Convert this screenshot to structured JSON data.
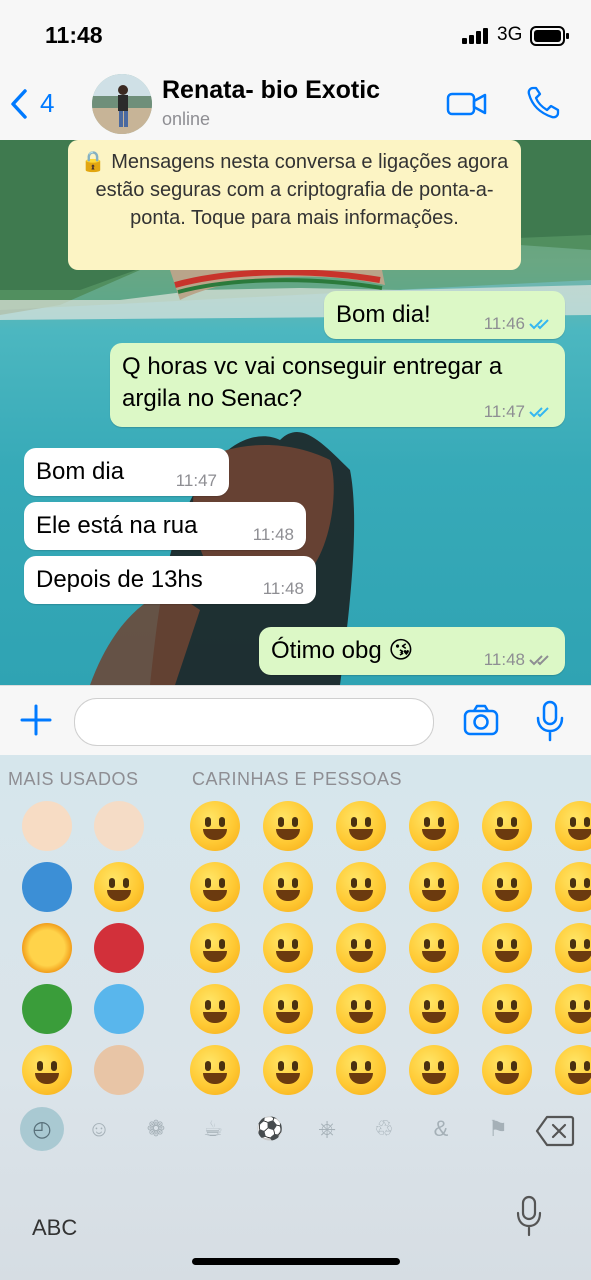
{
  "status_bar": {
    "time": "11:48",
    "network": "3G"
  },
  "nav": {
    "back_count": "4",
    "contact_name": "Renata- bio Exotic",
    "contact_status": "online"
  },
  "encryption_notice": "🔒 Mensagens nesta conversa e ligações agora estão seguras com a criptografia de ponta-a-ponta. Toque para mais informações.",
  "messages": [
    {
      "direction": "out",
      "text": "Bom dia!",
      "time": "11:46"
    },
    {
      "direction": "out",
      "text": "Q horas vc vai conseguir entregar a argila no Senac?",
      "time": "11:47"
    },
    {
      "direction": "in",
      "text": "Bom dia",
      "time": "11:47"
    },
    {
      "direction": "in",
      "text": "Ele está na rua",
      "time": "11:48"
    },
    {
      "direction": "in",
      "text": "Depois de 13hs",
      "time": "11:48"
    },
    {
      "direction": "out",
      "text": "Ótimo obg 😘",
      "time": "11:48"
    }
  ],
  "input": {
    "placeholder": ""
  },
  "keyboard": {
    "frequent_label": "MAIS USADOS",
    "smileys_label": "CARINHAS E PESSOAS",
    "frequent_emojis": [
      "ok-hand",
      "raising-hands",
      "dolphin",
      "smiling-face",
      "sun-with-face",
      "dancer",
      "shamrock",
      "droplet",
      "eye-roll",
      "facepalm"
    ],
    "abc_label": "ABC",
    "category_tabs": [
      "recent",
      "smileys",
      "animals",
      "food",
      "activity",
      "travel",
      "objects",
      "symbols",
      "flags"
    ]
  },
  "colors": {
    "ios_blue": "#007aff",
    "outgoing_bubble": "#dcf8c6",
    "incoming_bubble": "#ffffff",
    "notice_bg": "#fcf4c4",
    "read_ticks": "#34b7f1"
  }
}
